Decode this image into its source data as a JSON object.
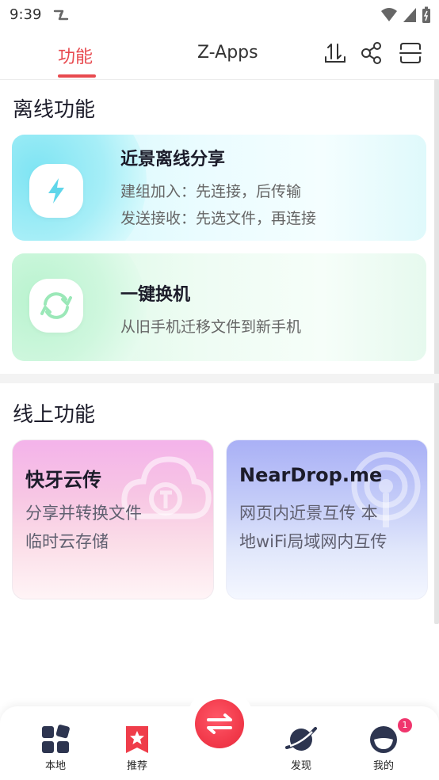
{
  "status_bar": {
    "time": "9:39"
  },
  "tabs": [
    {
      "label": "功能",
      "active": true
    },
    {
      "label": "Z-Apps",
      "active": false
    }
  ],
  "offline": {
    "title": "离线功能",
    "cards": [
      {
        "title": "近景离线分享",
        "line1": "建组加入：先连接，后传输",
        "line2": "发送接收：先选文件，再连接"
      },
      {
        "title": "一键换机",
        "line1": "从旧手机迁移文件到新手机"
      }
    ]
  },
  "online": {
    "title": "线上功能",
    "cards": [
      {
        "title": "快牙云传",
        "line1": "分享并转换文件",
        "line2": "临时云存储"
      },
      {
        "title": "NearDrop.me",
        "line1": "网页内近景互传 本",
        "line2": "地wiFi局域网内互传"
      }
    ]
  },
  "bottom_nav": {
    "items": [
      {
        "label": "本地",
        "icon": "grid-apps-icon"
      },
      {
        "label": "推荐",
        "icon": "star-bookmark-icon"
      },
      {
        "label": "发现",
        "icon": "planet-icon"
      },
      {
        "label": "我的",
        "icon": "avatar-icon"
      }
    ],
    "center_icon": "transfer-arrows-icon",
    "badge_count": "1"
  },
  "colors": {
    "accent": "#e84a4f",
    "badge": "#f0356d",
    "cyan": "#7ee4f3",
    "green": "#b9f3cf"
  }
}
